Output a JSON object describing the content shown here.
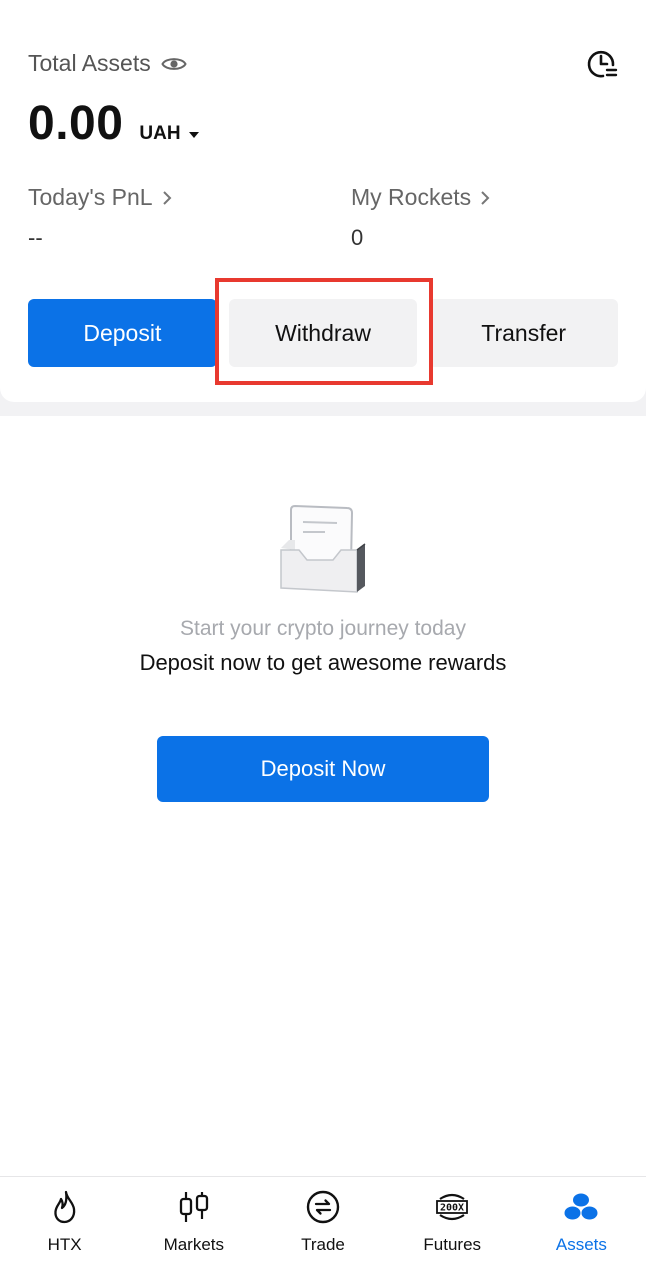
{
  "header": {
    "total_assets_label": "Total Assets",
    "balance_value": "0.00",
    "currency": "UAH"
  },
  "stats": {
    "pnl_label": "Today's PnL",
    "pnl_value": "--",
    "rockets_label": "My Rockets",
    "rockets_value": "0"
  },
  "actions": {
    "deposit_label": "Deposit",
    "withdraw_label": "Withdraw",
    "transfer_label": "Transfer"
  },
  "empty_state": {
    "subtitle": "Start your crypto journey today",
    "message": "Deposit now to get awesome rewards",
    "cta_label": "Deposit Now"
  },
  "nav": {
    "items": [
      {
        "label": "HTX",
        "icon": "flame-icon"
      },
      {
        "label": "Markets",
        "icon": "candlestick-icon"
      },
      {
        "label": "Trade",
        "icon": "swap-icon"
      },
      {
        "label": "Futures",
        "icon": "200x-icon"
      },
      {
        "label": "Assets",
        "icon": "assets-icon",
        "active": true
      }
    ]
  },
  "colors": {
    "accent": "#0b72e7",
    "highlight": "#e8392f"
  }
}
